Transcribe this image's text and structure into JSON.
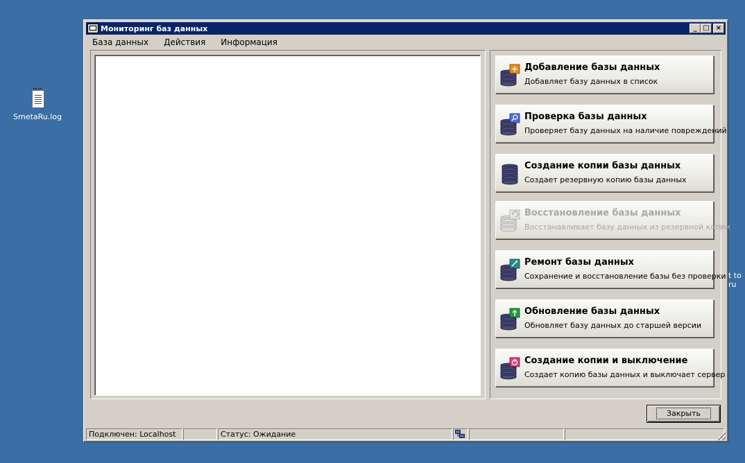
{
  "desktop": {
    "icons": [
      {
        "label": "SmetaRu.log",
        "icon": "notepad-document-icon"
      }
    ],
    "partial_label_lines": [
      "t to",
      "ru"
    ]
  },
  "window": {
    "title": "Мониторинг баз данных",
    "controls": {
      "minimize": "_",
      "maximize": "□",
      "close": "×"
    }
  },
  "menu": {
    "items": [
      "База данных",
      "Действия",
      "Информация"
    ]
  },
  "actions": [
    {
      "title": "Добавление базы данных",
      "description": "Добавляет базу данных в список",
      "icon": "database-add-icon",
      "badge_color": "#f08a1c",
      "enabled": true
    },
    {
      "title": "Проверка базы данных",
      "description": "Проверяет базу данных на наличие повреждений",
      "icon": "database-check-icon",
      "badge_color": "#4a6fe0",
      "enabled": true
    },
    {
      "title": "Создание копии базы данных",
      "description": "Создает резервную копию базы данных",
      "icon": "database-backup-icon",
      "badge_color": "",
      "enabled": true
    },
    {
      "title": "Восстановление базы данных",
      "description": "Восстанавливает базу данных из резервной копии",
      "icon": "database-restore-icon",
      "badge_color": "#c8c8c8",
      "enabled": false
    },
    {
      "title": "Ремонт базы данных",
      "description": "Сохранение и восстановление базы без проверки",
      "icon": "database-repair-icon",
      "badge_color": "#2a8a8a",
      "enabled": true
    },
    {
      "title": "Обновление базы данных",
      "description": "Обновляет базу данных до старшей версии",
      "icon": "database-update-icon",
      "badge_color": "#1f9a3a",
      "enabled": true
    },
    {
      "title": "Создание копии и выключение",
      "description": "Создает копию базы данных и выключает сервер",
      "icon": "database-shutdown-icon",
      "badge_color": "#e0407a",
      "enabled": true
    }
  ],
  "buttons": {
    "close_label": "Закрыть"
  },
  "statusbar": {
    "connection": "Подключен: Localhost",
    "status": "Статус: Ожидание"
  }
}
